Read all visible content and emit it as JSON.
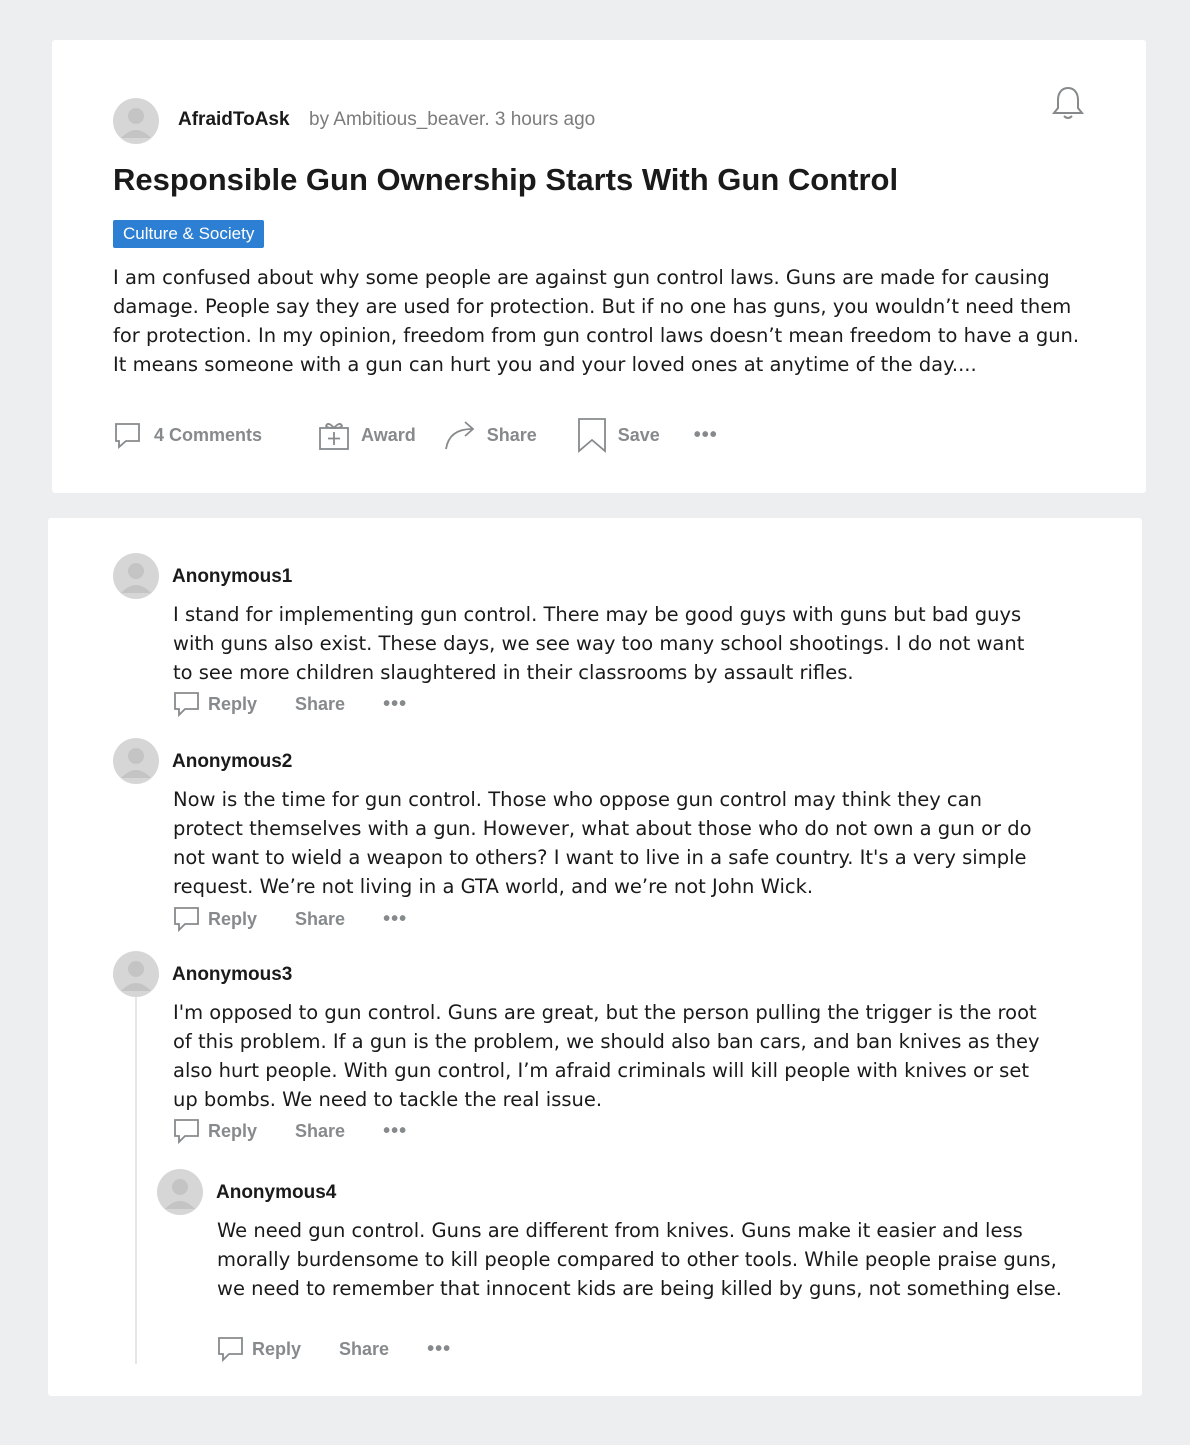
{
  "post": {
    "community": "AfraidToAsk",
    "meta": "by Ambitious_beaver. 3 hours ago",
    "title": "Responsible Gun Ownership Starts With Gun Control",
    "tag": "Culture & Society",
    "body": "I am confused about why some people are against gun control laws. Guns are made for causing damage. People say they are used for protection. But if no one has guns, you wouldn’t need them for protection. In my opinion, freedom from gun control laws doesn’t mean freedom to have a gun. It means someone with a gun can hurt you and your loved ones at anytime of the day....",
    "actions": {
      "comments": "4 Comments",
      "award": "Award",
      "share": "Share",
      "save": "Save"
    }
  },
  "comment_actions": {
    "reply": "Reply",
    "share": "Share"
  },
  "comments": [
    {
      "author": "Anonymous1",
      "body": "I stand for implementing gun control. There may be good guys with guns but bad guys with guns also exist. These days, we see way too many school shootings. I do not want to see more children slaughtered in their classrooms by assault rifles."
    },
    {
      "author": "Anonymous2",
      "body": "Now is the time for gun control. Those who oppose gun control may think they can protect themselves with a gun. However, what about those who do not own a gun or do not want to wield a weapon to others? I want to live in a safe country. It's a very simple request. We’re not living in a GTA world, and we’re not John Wick."
    },
    {
      "author": "Anonymous3",
      "body": "I'm opposed to gun control. Guns are great, but the person pulling the trigger is the root of this problem. If a gun is the problem, we should also ban cars, and ban knives as they also hurt people. With gun control, I’m afraid criminals will kill people with knives or set up bombs. We need to tackle the real issue."
    },
    {
      "author": "Anonymous4",
      "body": "We need gun control. Guns are different from knives. Guns make it easier and less morally burdensome to kill people compared to other tools. While people praise guns, we need to remember that innocent kids are being killed by guns, not something else."
    }
  ],
  "colors": {
    "page_bg": "#edeef0",
    "tag_bg": "#2d7fd3",
    "muted_text": "#878a8c"
  },
  "icons": [
    "avatar-placeholder",
    "bell-icon",
    "comment-icon",
    "award-icon",
    "share-arrow-icon",
    "bookmark-icon",
    "more-dots-icon"
  ]
}
